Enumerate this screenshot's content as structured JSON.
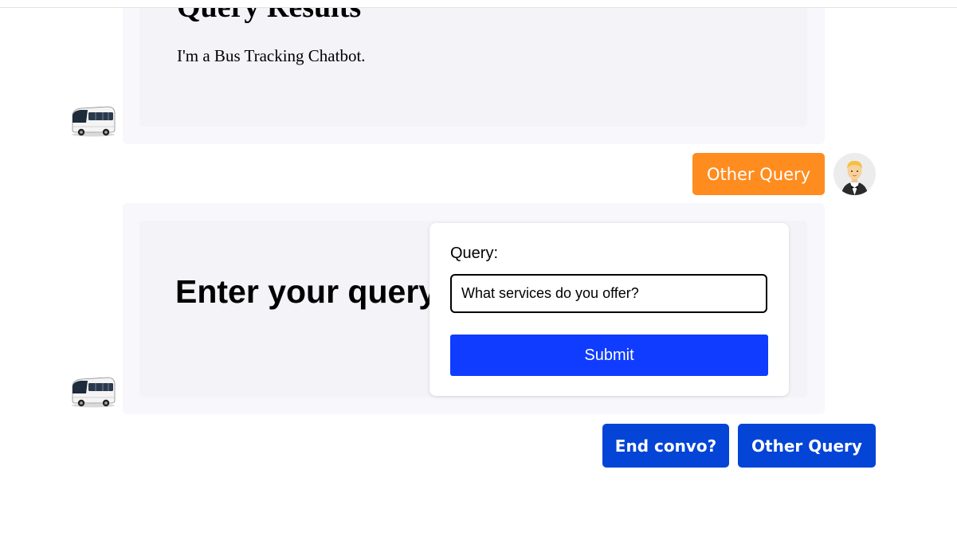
{
  "messages": {
    "results": {
      "title": "Query Results",
      "text": "I'm a Bus Tracking Chatbot."
    },
    "user_reply": {
      "label": "Other Query"
    },
    "query_prompt": {
      "title": "Enter your query",
      "form": {
        "label": "Query:",
        "value": "What services do you offer?",
        "submit_label": "Submit"
      }
    }
  },
  "actions": {
    "end_label": "End convo?",
    "other_label": "Other Query"
  },
  "icons": {
    "bot_avatar": "bus-icon",
    "user_avatar": "man-in-tuxedo-icon"
  },
  "colors": {
    "user_reply_button": "#ff8c1f",
    "submit_button": "#0f3cff",
    "action_button": "#0444d6",
    "bubble_background": "#f7f7fc"
  }
}
